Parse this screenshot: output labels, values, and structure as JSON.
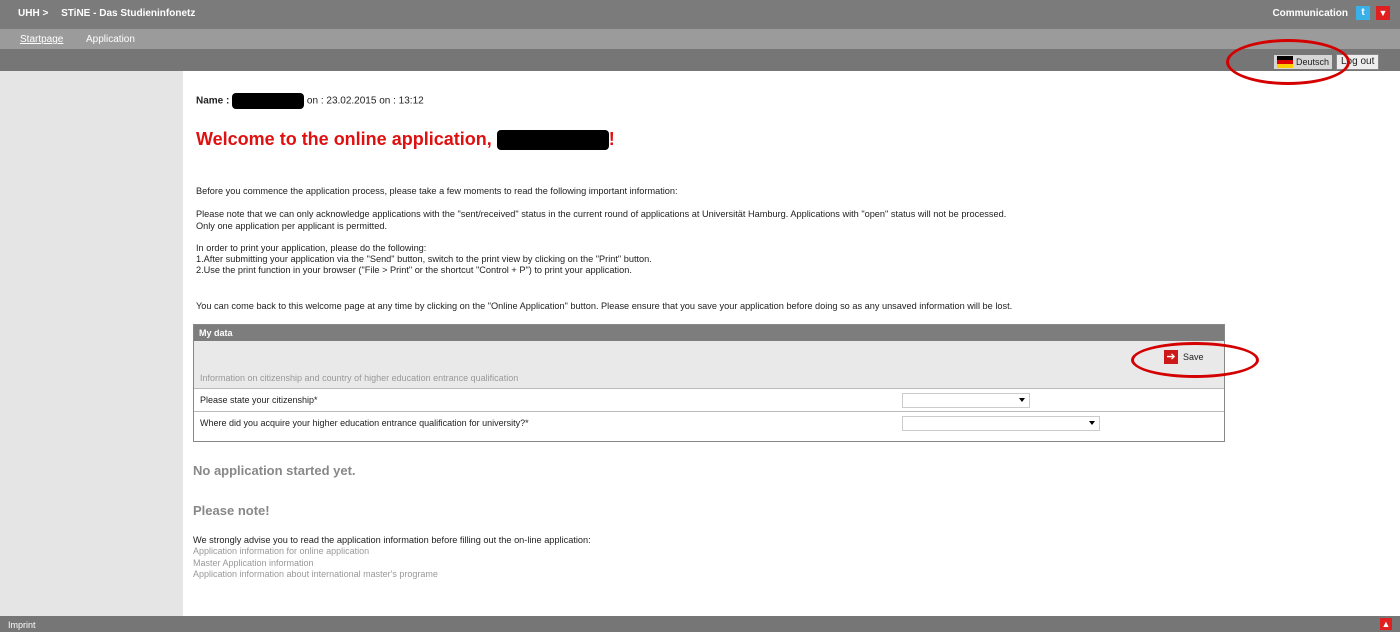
{
  "topbar": {
    "home": "UHH >",
    "portal": "STiNE - Das Studieninfonetz",
    "communication": "Communication"
  },
  "tabs": [
    "Startpage",
    "Application"
  ],
  "toolbar": {
    "language": "Deutsch",
    "logout": "Log out"
  },
  "session": {
    "name_label": "Name :",
    "date": "on : 23.02.2015",
    "time": "on : 13:12"
  },
  "welcome": {
    "title": "Welcome to the online application,",
    "punct": "!"
  },
  "info": {
    "p1": "Before you commence the application process, please take a few moments to read the following important information:",
    "p2a": "Please note that we can only acknowledge applications with the \"sent/received\" status in the current round of applications at Universität Hamburg. Applications with \"open\" status will not be processed.",
    "p2b": "Only one application per applicant is permitted.",
    "p3a": "In order to print your application, please do the following:",
    "p3b": "1.After submitting your application via the \"Send\" button, switch to the print view by clicking on the \"Print\" button.",
    "p3c": "2.Use the print function in your browser (\"File > Print\" or the shortcut \"Control + P\") to print your application.",
    "p4": "You can come back to this welcome page at any time by clicking on the \"Online Application\" button. Please ensure that you save your application before doing so as any unsaved information will be lost."
  },
  "mydata": {
    "header": "My data",
    "save": "Save",
    "section": "Information on citizenship and country of higher education entrance qualification",
    "q1": "Please state your citizenship*",
    "q2": "Where did you acquire your higher education entrance qualification for university?*"
  },
  "status": "No application started yet.",
  "note": {
    "title": "Please note!",
    "text": "We strongly advise you to read the application information before filling out the on-line application:",
    "links": [
      "Application information for online application",
      "Master Application information",
      "Application information about international master's programe"
    ]
  },
  "footer": {
    "imprint": "Imprint"
  },
  "icons": {
    "twitter": "twitter-icon",
    "dropdown": "chevron-down-icon",
    "save": "save-arrow-icon",
    "flag": "german-flag-icon",
    "top": "chevron-up-icon"
  },
  "colors": {
    "accent": "#e01010",
    "bar": "#7b7b7b"
  }
}
